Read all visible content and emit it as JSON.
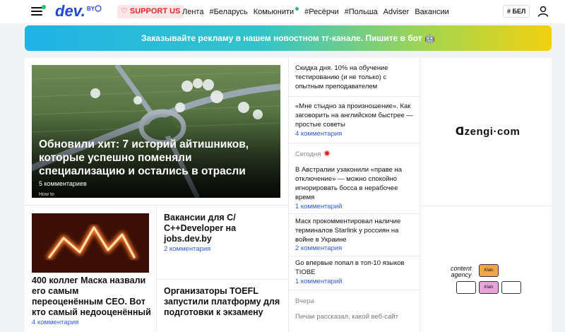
{
  "header": {
    "logo_text": "dev",
    "logo_suffix": "BY",
    "support_label": "SUPPORT US",
    "nav": [
      {
        "label": "Лента"
      },
      {
        "label": "#Беларусь"
      },
      {
        "label": "Комьюнити"
      },
      {
        "label": "#Ресёрчи"
      },
      {
        "label": "#Польша"
      },
      {
        "label": "Adviser"
      },
      {
        "label": "Вакансии"
      }
    ],
    "lang_label": "БЕЛ"
  },
  "banner": {
    "text": "Заказывайте рекламу в нашем новостном тг-канале. Пишите в бот 🤖"
  },
  "hero": {
    "title": "Обновили хит: 7 историй айтишников, которые успешно поменяли специализацию и остались в отрасли",
    "comments": "5 комментариев",
    "tag": "How to"
  },
  "cards": [
    {
      "title": "400 коллег Маска назвали его самым переоценённым CEO. Вот кто самый недооценённый",
      "comments": "4 комментария"
    },
    {
      "title": "Вакансии для C/ C++Developer на jobs.dev.by",
      "comments": "2 комментария"
    },
    {
      "title": "Организаторы TOEFL запустили платформу для подготовки к экзамену"
    }
  ],
  "news": {
    "items_top": [
      {
        "text": "Скидка дня. 10% на обучение тестированию (и не только) с опытным преподавателем"
      },
      {
        "text": "«Мне стыдно за произношение». Как заговорить на английском быстрее — простые советы",
        "comments": "4 комментария"
      }
    ],
    "section_today": "Сегодня",
    "items_today": [
      {
        "text": "В Австралии узаконили «праве на отключение» — можно спокойно игнорировать босса в нерабочее время",
        "comments": "1 комментарий"
      },
      {
        "text": "Маск прокомментировал наличие терминалов Starlink у россиян на войне в Украине",
        "comments": "2 комментария"
      },
      {
        "text": "Go впервые попал в топ-10 языков TIOBE",
        "comments": "1 комментарий"
      }
    ],
    "section_yesterday": "Вчера",
    "item_yesterday": "Пичаи рассказал, какой веб-сайт"
  },
  "ads": {
    "ad1_text": "ᗡzengi·com",
    "ad2_line1": "content",
    "ad2_line2": "agency",
    "ad2_key": "Klats"
  },
  "colors": {
    "accent_link": "#2d5bd6",
    "support_red": "#e0282b",
    "online_green": "#1ec26b"
  }
}
